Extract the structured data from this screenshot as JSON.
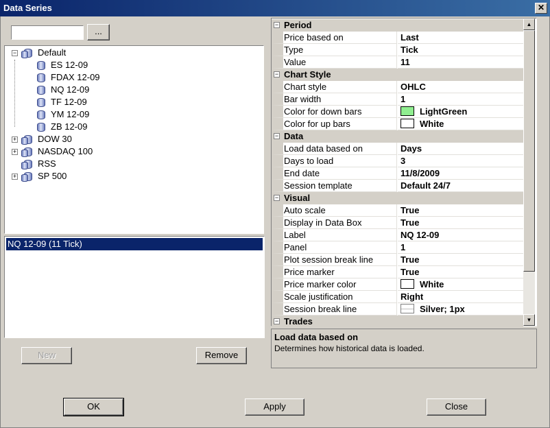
{
  "window": {
    "title": "Data Series",
    "close_glyph": "✕"
  },
  "left_panel": {
    "search": {
      "value": ""
    },
    "browse_label": "...",
    "tree": {
      "default_label": "Default",
      "children": [
        "ES 12-09",
        "FDAX 12-09",
        "NQ 12-09",
        "TF 12-09",
        "YM 12-09",
        "ZB 12-09"
      ],
      "others": [
        "DOW 30",
        "NASDAQ 100",
        "RSS",
        "SP 500"
      ]
    },
    "selected_series": [
      "NQ 12-09 (11 Tick)"
    ],
    "new_label": "New",
    "remove_label": "Remove"
  },
  "grid": {
    "sections": [
      {
        "name": "Period",
        "props": [
          {
            "name": "Price based on",
            "value": "Last"
          },
          {
            "name": "Type",
            "value": "Tick"
          },
          {
            "name": "Value",
            "value": "11"
          }
        ]
      },
      {
        "name": "Chart Style",
        "props": [
          {
            "name": "Chart style",
            "value": "OHLC"
          },
          {
            "name": "Bar width",
            "value": "1"
          },
          {
            "name": "Color for down bars",
            "value": "LightGreen",
            "color": "#90ee90"
          },
          {
            "name": "Color for up bars",
            "value": "White",
            "color": "#ffffff"
          }
        ]
      },
      {
        "name": "Data",
        "props": [
          {
            "name": "Load data based on",
            "value": "Days"
          },
          {
            "name": "Days to load",
            "value": "3"
          },
          {
            "name": "End date",
            "value": "11/8/2009"
          },
          {
            "name": "Session template",
            "value": "Default 24/7"
          }
        ]
      },
      {
        "name": "Visual",
        "props": [
          {
            "name": "Auto scale",
            "value": "True"
          },
          {
            "name": "Display in Data Box",
            "value": "True"
          },
          {
            "name": "Label",
            "value": "NQ 12-09"
          },
          {
            "name": "Panel",
            "value": "1"
          },
          {
            "name": "Plot session break line",
            "value": "True"
          },
          {
            "name": "Price marker",
            "value": "True"
          },
          {
            "name": "Price marker color",
            "value": "White",
            "color": "#ffffff"
          },
          {
            "name": "Scale justification",
            "value": "Right"
          },
          {
            "name": "Session break line",
            "value": "Silver; 1px",
            "line": "#c0c0c0"
          }
        ]
      },
      {
        "name": "Trades",
        "props": []
      }
    ]
  },
  "description": {
    "title": "Load data based on",
    "text": "Determines how historical data is loaded."
  },
  "buttons": {
    "ok": "OK",
    "apply": "Apply",
    "close": "Close"
  }
}
